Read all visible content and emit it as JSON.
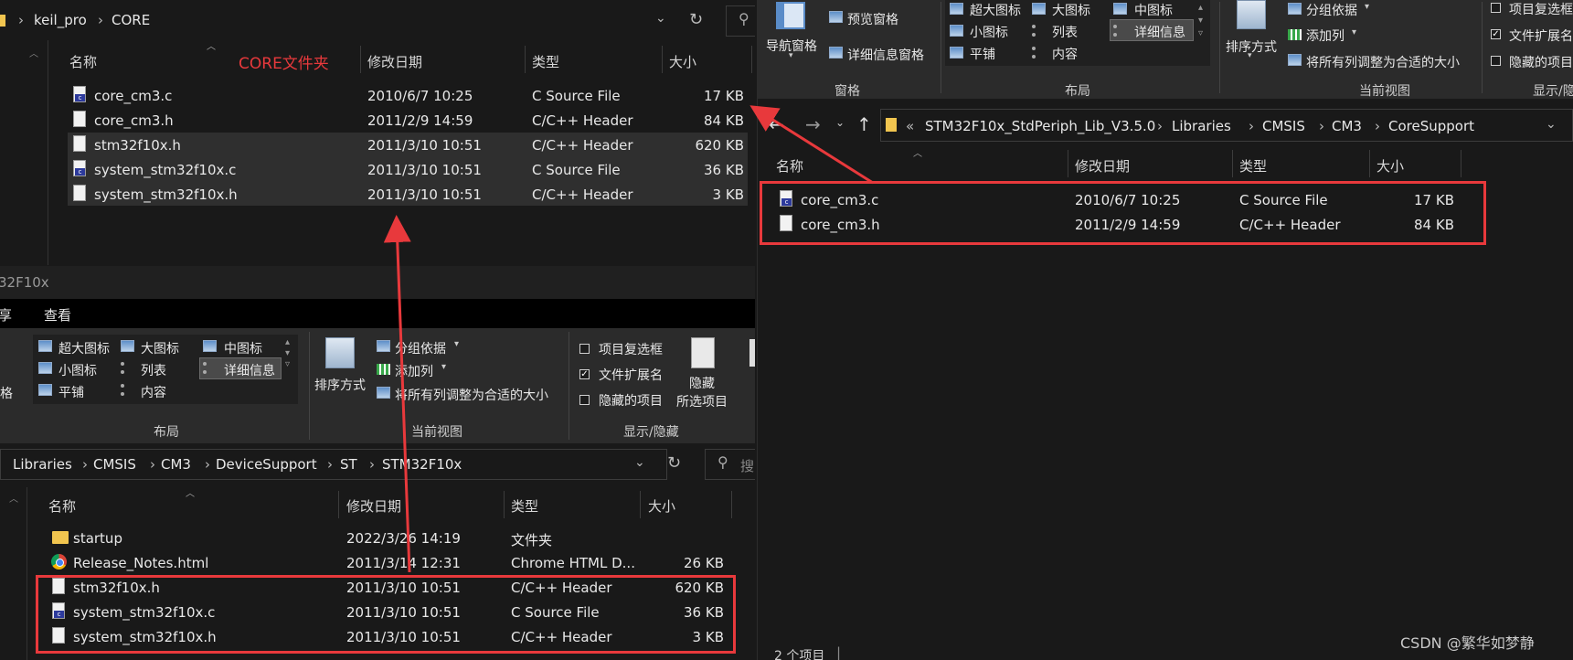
{
  "left_top": {
    "path": [
      "keil_pro",
      "CORE"
    ],
    "annotation": "CORE文件夹",
    "columns": {
      "name": "名称",
      "date": "修改日期",
      "type": "类型",
      "size": "大小"
    },
    "files": [
      {
        "name": "core_cm3.c",
        "date": "2010/6/7 10:25",
        "type": "C Source File",
        "size": "17 KB",
        "icon": "c-source-file-icon"
      },
      {
        "name": "core_cm3.h",
        "date": "2011/2/9 14:59",
        "type": "C/C++ Header",
        "size": "84 KB",
        "icon": "header-file-icon"
      },
      {
        "name": "stm32f10x.h",
        "date": "2011/3/10 10:51",
        "type": "C/C++ Header",
        "size": "620 KB",
        "icon": "header-file-icon"
      },
      {
        "name": "system_stm32f10x.c",
        "date": "2011/3/10 10:51",
        "type": "C Source File",
        "size": "36 KB",
        "icon": "c-source-file-icon"
      },
      {
        "name": "system_stm32f10x.h",
        "date": "2011/3/10 10:51",
        "type": "C/C++ Header",
        "size": "3 KB",
        "icon": "header-file-icon"
      }
    ]
  },
  "left_bottom": {
    "window_title": "32F10x",
    "tabs": [
      "享",
      "查看"
    ],
    "layout_options": [
      "超大图标",
      "大图标",
      "中图标",
      "小图标",
      "列表",
      "详细信息",
      "平铺",
      "内容"
    ],
    "pane_label_fragment": "窗格",
    "sort_by": "排序方式",
    "group_by": "分组依据",
    "add_column": "添加列",
    "fit_columns": "将所有列调整为合适的大小",
    "checkboxes": [
      {
        "label": "项目复选框",
        "checked": false
      },
      {
        "label": "文件扩展名",
        "checked": true
      },
      {
        "label": "隐藏的项目",
        "checked": false
      }
    ],
    "hide_selected_line1": "隐藏",
    "hide_selected_line2": "所选项目",
    "group_layout": "布局",
    "group_current_view": "当前视图",
    "group_show_hide": "显示/隐藏",
    "path": [
      "Libraries",
      "CMSIS",
      "CM3",
      "DeviceSupport",
      "ST",
      "STM32F10x"
    ],
    "search_fragment": "搜",
    "columns": {
      "name": "名称",
      "date": "修改日期",
      "type": "类型",
      "size": "大小"
    },
    "files": [
      {
        "name": "startup",
        "date": "2022/3/26 14:19",
        "type": "文件夹",
        "size": "",
        "icon": "folder-icon"
      },
      {
        "name": "Release_Notes.html",
        "date": "2011/3/14 12:31",
        "type": "Chrome HTML D...",
        "size": "26 KB",
        "icon": "chrome-icon"
      },
      {
        "name": "stm32f10x.h",
        "date": "2011/3/10 10:51",
        "type": "C/C++ Header",
        "size": "620 KB",
        "icon": "header-file-icon"
      },
      {
        "name": "system_stm32f10x.c",
        "date": "2011/3/10 10:51",
        "type": "C Source File",
        "size": "36 KB",
        "icon": "c-source-file-icon"
      },
      {
        "name": "system_stm32f10x.h",
        "date": "2011/3/10 10:51",
        "type": "C/C++ Header",
        "size": "3 KB",
        "icon": "header-file-icon"
      }
    ]
  },
  "right": {
    "nav_pane": "导航窗格",
    "preview_pane": "预览窗格",
    "details_pane": "详细信息窗格",
    "layout_options": [
      "超大图标",
      "大图标",
      "中图标",
      "小图标",
      "列表",
      "详细信息",
      "平铺",
      "内容"
    ],
    "sort_by": "排序方式",
    "group_by": "分组依据",
    "add_column": "添加列",
    "fit_columns": "将所有列调整为合适的大小",
    "checkboxes": [
      {
        "label": "项目复选框",
        "checked": false
      },
      {
        "label": "文件扩展名",
        "checked": true
      },
      {
        "label": "隐藏的项目",
        "checked": false
      }
    ],
    "group_panes": "窗格",
    "group_layout": "布局",
    "group_current_view": "当前视图",
    "group_show_hide": "显示/隐藏",
    "path": [
      "STM32F10x_StdPeriph_Lib_V3.5.0",
      "Libraries",
      "CMSIS",
      "CM3",
      "CoreSupport"
    ],
    "columns": {
      "name": "名称",
      "date": "修改日期",
      "type": "类型",
      "size": "大小"
    },
    "files": [
      {
        "name": "core_cm3.c",
        "date": "2010/6/7 10:25",
        "type": "C Source File",
        "size": "17 KB",
        "icon": "c-source-file-icon"
      },
      {
        "name": "core_cm3.h",
        "date": "2011/2/9 14:59",
        "type": "C/C++ Header",
        "size": "84 KB",
        "icon": "header-file-icon"
      }
    ],
    "status": "2 个项目",
    "watermark": "CSDN @繁华如梦静"
  },
  "colors": {
    "background": "#191919",
    "ribbon": "#2b2b2b",
    "highlight_box": "#e8393c",
    "annotation": "#e8393c"
  }
}
